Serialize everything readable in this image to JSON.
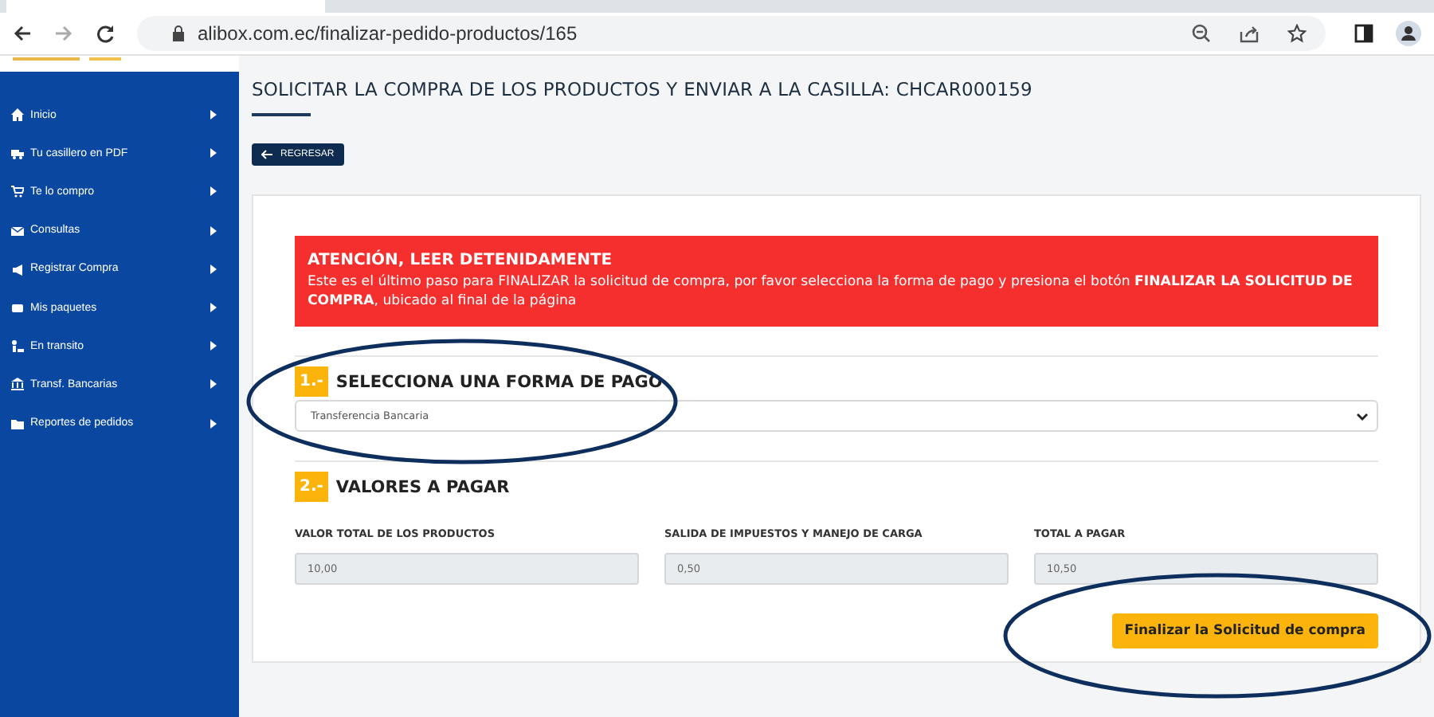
{
  "browser": {
    "url": "alibox.com.ec/finalizar-pedido-productos/165"
  },
  "sidebar": {
    "items": [
      {
        "label": "Inicio"
      },
      {
        "label": "Tu casillero en PDF"
      },
      {
        "label": "Te lo compro"
      },
      {
        "label": "Consultas"
      },
      {
        "label": "Registrar Compra"
      },
      {
        "label": "Mis paquetes"
      },
      {
        "label": "En transito"
      },
      {
        "label": "Transf. Bancarias"
      },
      {
        "label": "Reportes de pedidos"
      }
    ]
  },
  "page": {
    "title": "SOLICITAR LA COMPRA DE LOS PRODUCTOS Y ENVIAR A LA CASILLA: CHCAR000159",
    "back_button": "REGRESAR",
    "alert": {
      "title": "ATENCIÓN, LEER DETENIDAMENTE",
      "text": "Este es el último paso para FINALIZAR la solicitud de compra, por favor selecciona la forma de pago y presiona el botón **FINALIZAR LA SOLICITUD DE COMPRA**, ubicado al final de la página"
    },
    "step1": {
      "number": "1.-",
      "title": "SELECCIONA UNA FORMA DE PAGO",
      "select_value": "Transferencia Bancaria"
    },
    "step2": {
      "number": "2.-",
      "title": "VALORES A PAGAR",
      "fields": [
        {
          "label": "VALOR TOTAL DE LOS PRODUCTOS",
          "value": "10,00"
        },
        {
          "label": "SALIDA DE IMPUESTOS Y MANEJO DE CARGA",
          "value": "0,50"
        },
        {
          "label": "TOTAL A PAGAR",
          "value": "10,50"
        }
      ]
    },
    "submit_button": "Finalizar la Solicitud de compra"
  }
}
